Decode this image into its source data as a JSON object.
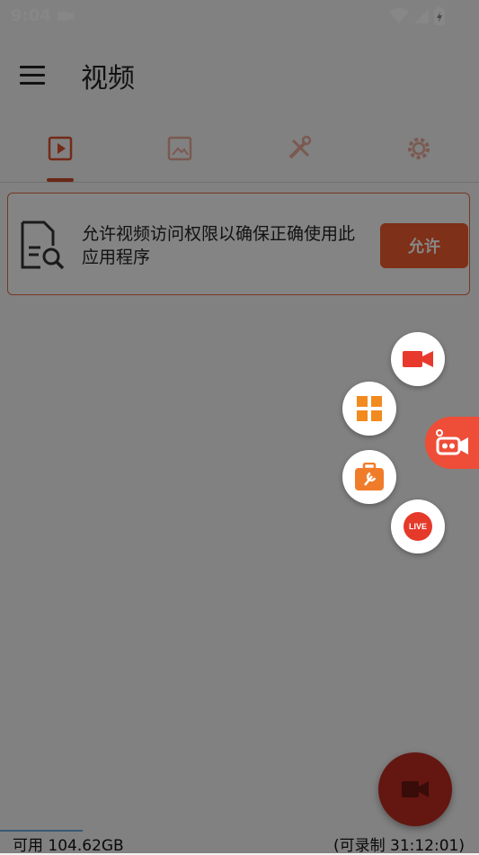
{
  "status_bar": {
    "time": "9:04"
  },
  "toolbar": {
    "title": "视频"
  },
  "tabs": [
    {
      "name": "video",
      "icon": "video-tab-icon",
      "selected": true
    },
    {
      "name": "images",
      "icon": "image-tab-icon",
      "selected": false
    },
    {
      "name": "tools",
      "icon": "tools-tab-icon",
      "selected": false
    },
    {
      "name": "settings",
      "icon": "gear-tab-icon",
      "selected": false
    }
  ],
  "permission_banner": {
    "message": "允许视频访问权限以确保正确使用此应用程序",
    "allow_label": "允许"
  },
  "floating_menu": {
    "live_label": "LIVE"
  },
  "bottom_bar": {
    "available": "可用 104.62GB",
    "recordable": "(可录制 31:12:01)"
  },
  "colors": {
    "accent": "#ef5b2f",
    "fab": "#be2a21",
    "float_main": "#ee4d38"
  }
}
